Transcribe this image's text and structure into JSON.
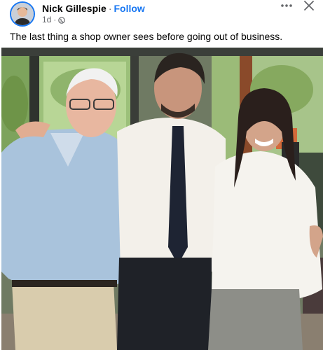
{
  "post": {
    "author_name": "Nick Gillespie",
    "separator": "·",
    "follow_label": "Follow",
    "timestamp": "1d",
    "meta_separator": "·",
    "privacy_icon": "globe-icon",
    "caption": "The last thing a shop owner sees before going out of business."
  },
  "controls": {
    "more_icon": "more-horizontal-icon",
    "close_icon": "close-icon"
  },
  "colors": {
    "accent": "#1877f2",
    "secondary_text": "#65676b",
    "primary_text": "#050505"
  }
}
